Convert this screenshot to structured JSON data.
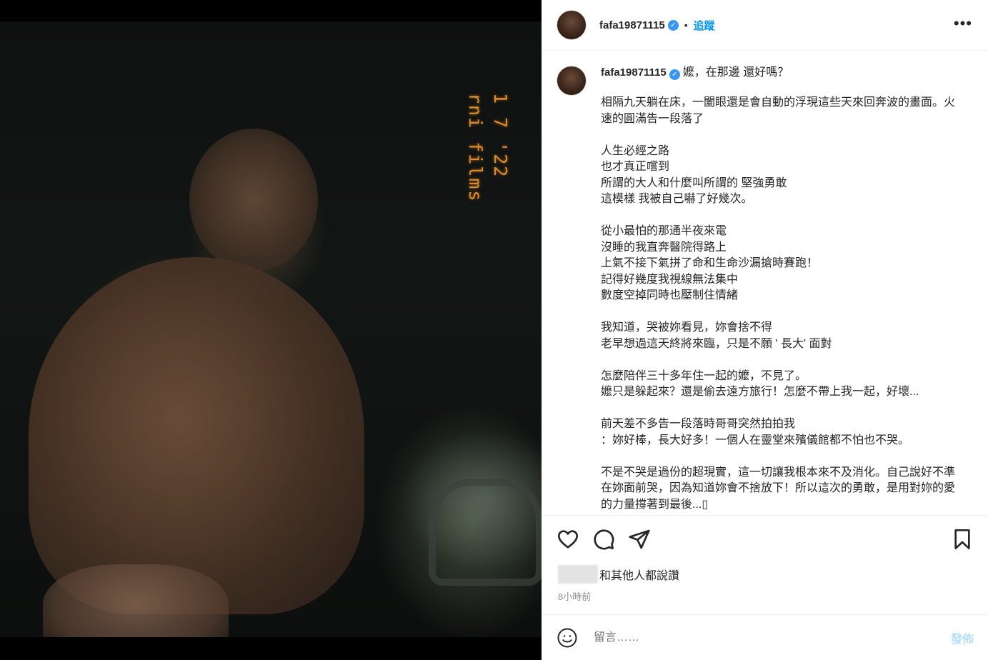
{
  "photo": {
    "stamp_line1": "1 7 '22",
    "stamp_line2": "rni films"
  },
  "header": {
    "username": "fafa19871115",
    "separator": "•",
    "follow_label": "追蹤",
    "more_label": "•••"
  },
  "caption": {
    "username": "fafa19871115",
    "first_line": "嬤，在那邊 還好嗎？",
    "body": "相隔九天躺在床，一闔眼還是會自動的浮現這些天來回奔波的畫面。火速的圓滿告一段落了\n\n人生必經之路\n也才真正嚐到\n所謂的大人和什麼叫所謂的 堅強勇敢\n這模樣 我被自己嚇了好幾次。\n\n從小最怕的那通半夜來電\n沒睡的我直奔醫院得路上\n上氣不接下氣拼了命和生命沙漏搶時賽跑！\n記得好幾度我視線無法集中\n數度空掉同時也壓制住情緒\n\n我知道，哭被妳看見，妳會捨不得\n老早想過這天終將來臨，只是不願 ' 長大' 面對\n\n怎麼陪伴三十多年住一起的嬤，不見了。\n嬤只是躲起來？還是偷去遠方旅行！怎麼不帶上我一起，好壞...\n\n前天差不多告一段落時哥哥突然拍拍我\n：妳好棒，長大好多！一個人在靈堂來殯儀館都不怕也不哭。\n\n不是不哭是過份的超現實，這一切讓我根本來不及消化。自己說好不準在妳面前哭，因為知道妳會不捨放下！所以這次的勇敢，是用對妳的愛的力量撐著到最後...▯"
  },
  "actions": {
    "like_icon": "heart-icon",
    "comment_icon": "comment-icon",
    "share_icon": "send-icon",
    "save_icon": "bookmark-icon"
  },
  "likes": {
    "text": "和其他人都說讚"
  },
  "timestamp": "8小時前",
  "comment": {
    "placeholder": "留言……",
    "post_label": "發佈",
    "emoji_icon": "emoji-icon"
  },
  "colors": {
    "accent": "#0095f6",
    "verified": "#3897f0",
    "post_disabled": "#b2dffc",
    "film_stamp": "#e08a2a"
  }
}
